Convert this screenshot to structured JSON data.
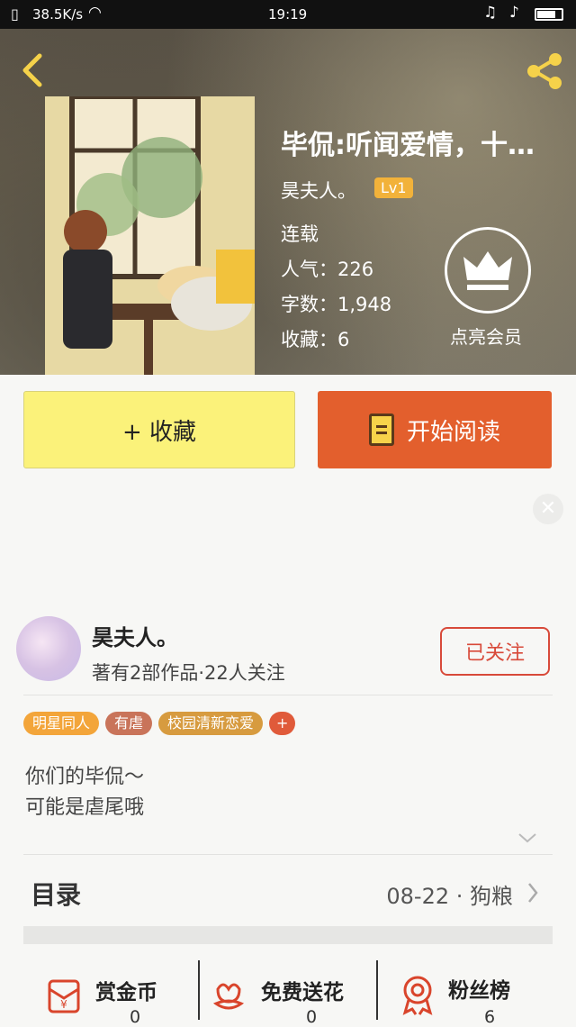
{
  "status": {
    "speed": "38.5K/s",
    "time": "19:19"
  },
  "book": {
    "title": "毕侃:听闻爱情，十…",
    "author": "昊夫人。",
    "level": "Lv1",
    "status": "连载",
    "popularity_label": "人气：226",
    "words_label": "字数：1,948",
    "favorites_label": "收藏：6",
    "vip_label": "点亮会员"
  },
  "actions": {
    "collect": "+ 收藏",
    "read": "开始阅读"
  },
  "author_card": {
    "name": "昊夫人。",
    "info": "著有2部作品·22人关注",
    "follow": "已关注"
  },
  "tags": [
    {
      "label": "明星同人",
      "color": "#f3a53a"
    },
    {
      "label": "有虐",
      "color": "#c9745a"
    },
    {
      "label": "校园清新恋爱",
      "color": "#d79b3f"
    },
    {
      "label": "+",
      "color": "#e05a3a"
    }
  ],
  "description": {
    "line1": "你们的毕侃～",
    "line2": "可能是虐尾哦"
  },
  "toc": {
    "label": "目录",
    "latest": "08-22 · 狗粮"
  },
  "stats": [
    {
      "label": "赏金币",
      "value": "0",
      "icon": "red-envelope-icon"
    },
    {
      "label": "免费送花",
      "value": "0",
      "icon": "flower-icon"
    },
    {
      "label": "粉丝榜",
      "value": "6",
      "icon": "medal-icon"
    }
  ],
  "colors": {
    "accent_red": "#e35f2d",
    "yellow_btn": "#fbf27a",
    "tag_orange": "#f3a53a"
  }
}
